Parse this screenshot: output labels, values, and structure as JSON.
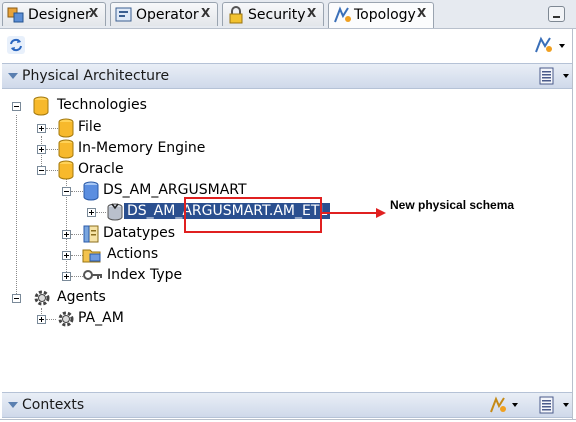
{
  "tabs": [
    {
      "label": "Designer",
      "icon": "designer-icon",
      "close": "X",
      "active": false
    },
    {
      "label": "Operator",
      "icon": "operator-icon",
      "close": "X",
      "active": false
    },
    {
      "label": "Security",
      "icon": "security-icon",
      "close": "X",
      "active": false
    },
    {
      "label": "Topology",
      "icon": "topology-icon",
      "close": "X",
      "active": true
    }
  ],
  "physical_architecture": {
    "title": "Physical Architecture",
    "tree": {
      "technologies": "Technologies",
      "file": "File",
      "in_memory": "In-Memory Engine",
      "oracle": "Oracle",
      "data_server": "DS_AM_ARGUSMART",
      "schema": "DS_AM_ARGUSMART.AM_ETL",
      "datatypes": "Datatypes",
      "actions": "Actions",
      "index_type": "Index Type",
      "agents": "Agents",
      "agent_pa_am": "PA_AM"
    }
  },
  "contexts": {
    "title": "Contexts"
  },
  "callout": {
    "text": "New physical schema"
  },
  "colors": {
    "selection": "#2a4f8f",
    "callout": "#e02020",
    "header": "#cfd9ea"
  }
}
